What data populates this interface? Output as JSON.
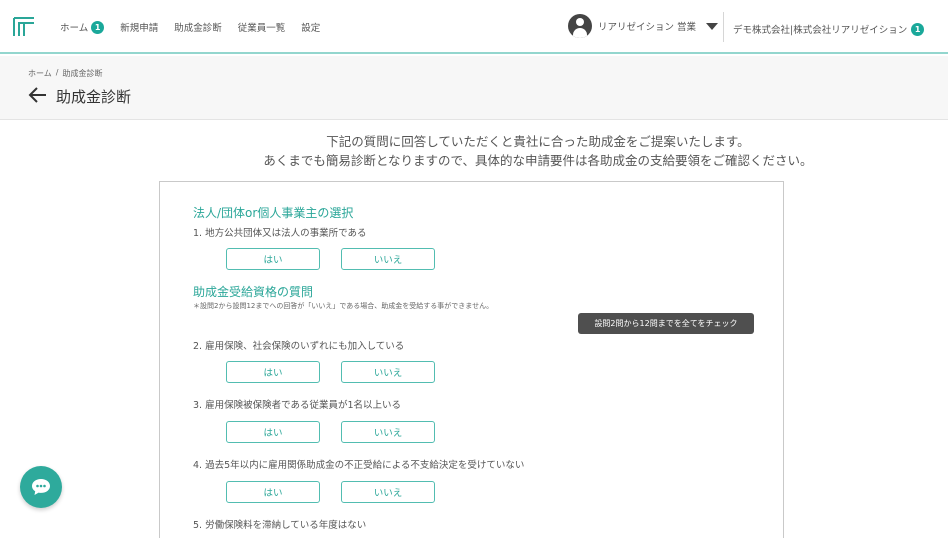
{
  "header": {
    "nav": [
      {
        "label": "ホーム",
        "badge": "1"
      },
      {
        "label": "新規申請"
      },
      {
        "label": "助成金診断"
      },
      {
        "label": "従業員一覧"
      },
      {
        "label": "設定"
      }
    ],
    "user_name": "リアリゼイション 営業",
    "company": "デモ株式会社|株式会社リアリゼイション",
    "company_badge": "1"
  },
  "breadcrumb": {
    "home": "ホーム",
    "separator": "/",
    "current": "助成金診断"
  },
  "page_title": "助成金診断",
  "intro": {
    "line1": "下記の質問に回答していただくと貴社に合った助成金をご提案いたします。",
    "line2": "あくまでも簡易診断となりますので、具体的な申請要件は各助成金の支給要領をご確認ください。"
  },
  "form": {
    "section1_title": "法人/団体or個人事業主の選択",
    "section2_title": "助成金受給資格の質問",
    "section2_note": "＊設問2から設問12までへの回答が「いいえ」である場合、助成金を受給する事ができません。",
    "check_all_button": "設問2問から12問までを全てをチェック",
    "yes_label": "はい",
    "no_label": "いいえ",
    "questions": [
      "1. 地方公共団体又は法人の事業所である",
      "2. 雇用保険、社会保険のいずれにも加入している",
      "3. 雇用保険被保険者である従業員が1名以上いる",
      "4. 過去5年以内に雇用関係助成金の不正受給による不支給決定を受けていない",
      "5. 労働保険料を滞納している年度はない"
    ]
  },
  "colors": {
    "accent": "#2aa698",
    "header_border": "#93d6ce",
    "tooltip_bg": "#4f4f4f"
  }
}
